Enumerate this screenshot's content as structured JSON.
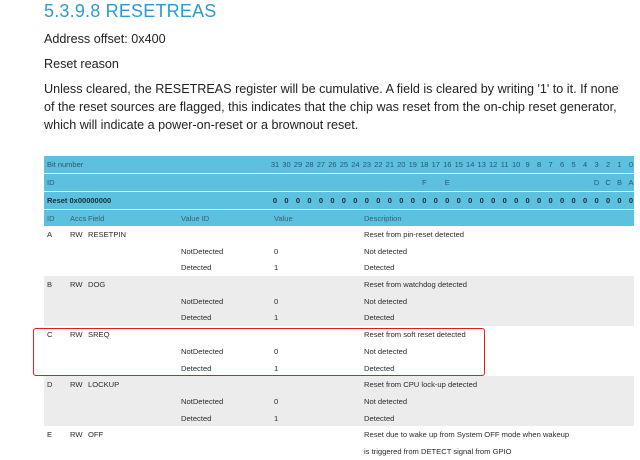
{
  "section_title": "5.3.9.8 RESETREAS",
  "address_offset": "Address offset: 0x400",
  "heading": "Reset reason",
  "description_lines": [
    "Unless cleared, the RESETREAS register will be cumulative. A field is cleared by writing '1' to it. If none",
    "of the reset sources are flagged, this indicates that the chip was reset from the on-chip reset generator,",
    "which will indicate a power-on-reset or a brownout reset."
  ],
  "register": {
    "bit_number_label": "Bit number",
    "id_label": "ID",
    "reset_label": "Reset 0x00000000",
    "bit_numbers": [
      "31",
      "30",
      "29",
      "28",
      "27",
      "26",
      "25",
      "24",
      "23",
      "22",
      "21",
      "20",
      "19",
      "18",
      "17",
      "16",
      "15",
      "14",
      "13",
      "12",
      "11",
      "10",
      "9",
      "8",
      "7",
      "6",
      "5",
      "4",
      "3",
      "2",
      "1",
      "0"
    ],
    "id_letters": [
      "",
      "",
      "",
      "",
      "",
      "",
      "",
      "",
      "",
      "",
      "",
      "",
      "",
      "F",
      "",
      "E",
      "",
      "",
      "",
      "",
      "",
      "",
      "",
      "",
      "",
      "",
      "",
      "",
      "D",
      "C",
      "B",
      "A"
    ],
    "reset_values": [
      "0",
      "0",
      "0",
      "0",
      "0",
      "0",
      "0",
      "0",
      "0",
      "0",
      "0",
      "0",
      "0",
      "0",
      "0",
      "0",
      "0",
      "0",
      "0",
      "0",
      "0",
      "0",
      "0",
      "0",
      "0",
      "0",
      "0",
      "0",
      "0",
      "0",
      "0",
      "0"
    ],
    "columns": {
      "id": "ID",
      "acc": "Accs",
      "field": "Field",
      "value_id": "Value ID",
      "value": "Value",
      "description": "Description"
    },
    "rows": [
      {
        "id": "A",
        "acc": "RW",
        "field": "RESETPIN",
        "value_id": "",
        "value": "",
        "description": "Reset from pin-reset detected"
      },
      {
        "id": "",
        "acc": "",
        "field": "",
        "value_id": "NotDetected",
        "value": "0",
        "description": "Not detected"
      },
      {
        "id": "",
        "acc": "",
        "field": "",
        "value_id": "Detected",
        "value": "1",
        "description": "Detected"
      },
      {
        "id": "B",
        "acc": "RW",
        "field": "DOG",
        "value_id": "",
        "value": "",
        "description": "Reset from watchdog detected"
      },
      {
        "id": "",
        "acc": "",
        "field": "",
        "value_id": "NotDetected",
        "value": "0",
        "description": "Not detected"
      },
      {
        "id": "",
        "acc": "",
        "field": "",
        "value_id": "Detected",
        "value": "1",
        "description": "Detected"
      },
      {
        "id": "C",
        "acc": "RW",
        "field": "SREQ",
        "value_id": "",
        "value": "",
        "description": "Reset from soft reset detected"
      },
      {
        "id": "",
        "acc": "",
        "field": "",
        "value_id": "NotDetected",
        "value": "0",
        "description": "Not detected"
      },
      {
        "id": "",
        "acc": "",
        "field": "",
        "value_id": "Detected",
        "value": "1",
        "description": "Detected"
      },
      {
        "id": "D",
        "acc": "RW",
        "field": "LOCKUP",
        "value_id": "",
        "value": "",
        "description": "Reset from CPU lock-up detected"
      },
      {
        "id": "",
        "acc": "",
        "field": "",
        "value_id": "NotDetected",
        "value": "0",
        "description": "Not detected"
      },
      {
        "id": "",
        "acc": "",
        "field": "",
        "value_id": "Detected",
        "value": "1",
        "description": "Detected"
      },
      {
        "id": "E",
        "acc": "RW",
        "field": "OFF",
        "value_id": "",
        "value": "",
        "description": "Reset due to wake up from System OFF mode when wakeup"
      },
      {
        "id": "",
        "acc": "",
        "field": "",
        "value_id": "",
        "value": "",
        "description": "is triggered from DETECT signal from GPIO"
      }
    ]
  },
  "highlight_color": "#e21b1b",
  "header_color": "#5bc1de",
  "title_color": "#2a9bd2"
}
